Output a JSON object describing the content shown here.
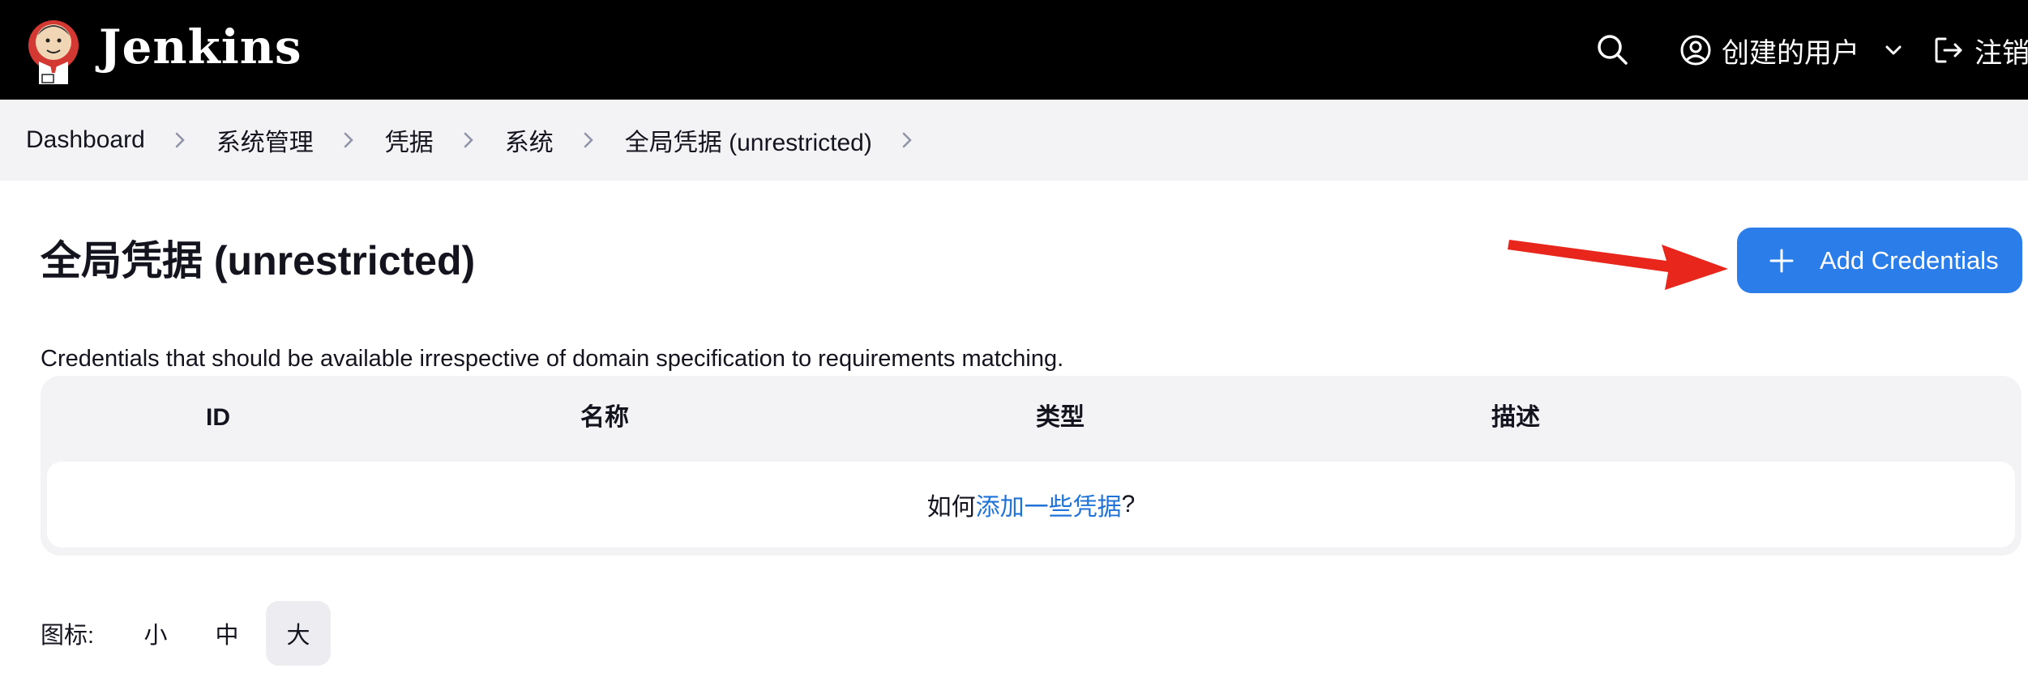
{
  "header": {
    "brand": "Jenkins",
    "user_label": "创建的用户",
    "logout_label": "注销",
    "icons": [
      "jenkins-logo-icon",
      "search-icon",
      "user-circle-icon",
      "chevron-down-icon",
      "logout-icon"
    ]
  },
  "breadcrumb": {
    "items": [
      "Dashboard",
      "系统管理",
      "凭据",
      "系统",
      "全局凭据 (unrestricted)"
    ]
  },
  "main": {
    "title": "全局凭据 (unrestricted)",
    "add_button_label": "Add Credentials",
    "description": "Credentials that should be available irrespective of domain specification to requirements matching."
  },
  "table": {
    "columns": [
      "ID",
      "名称",
      "类型",
      "描述"
    ],
    "empty_prefix": "如何",
    "empty_link": "添加一些凭据",
    "empty_suffix": "?"
  },
  "icon_size": {
    "label": "图标:",
    "options": [
      "小",
      "中",
      "大"
    ],
    "selected": "大"
  },
  "colors": {
    "header_bg": "#000000",
    "primary": "#2b7de9",
    "link": "#1f73d8",
    "annotation_arrow": "#e8261c"
  }
}
